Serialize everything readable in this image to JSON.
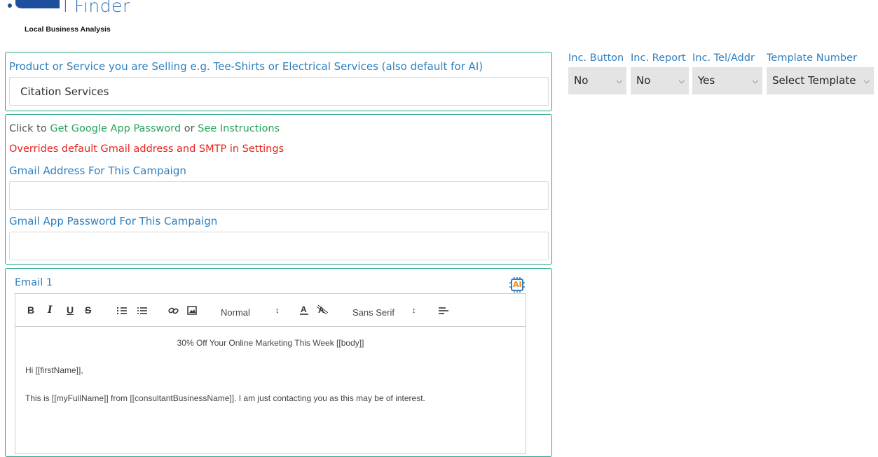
{
  "header": {
    "logo_text": "l Finder",
    "tagline": "Local Business Analysis"
  },
  "product": {
    "label": "Product or Service you are Selling e.g. Tee-Shirts or Electrical Services (also default for AI)",
    "value": "Citation Services"
  },
  "options": {
    "button": {
      "label": "Inc. Button",
      "value": "No"
    },
    "report": {
      "label": "Inc. Report",
      "value": "No"
    },
    "telAddr": {
      "label": "Inc. Tel/Addr",
      "value": "Yes"
    },
    "template": {
      "label": "Template Number",
      "value": "Select Template"
    }
  },
  "gmail": {
    "click_to": "Click to",
    "get_password_link": "Get Google App Password",
    "or": "or",
    "see_instructions_link": "See Instructions",
    "override_note": "Overrides default Gmail address and SMTP in Settings",
    "address_label": "Gmail Address For This Campaign",
    "address_value": "",
    "password_label": "Gmail App Password For This Campaign",
    "password_value": ""
  },
  "email": {
    "title": "Email 1",
    "ai_badge": "AI",
    "toolbar": {
      "bold": "B",
      "italic": "I",
      "underline": "U",
      "strike": "S",
      "size": "Normal",
      "font": "Sans Serif"
    },
    "body": {
      "subject_line": "30% Off Your Online Marketing This Week [[body]]",
      "greeting": "Hi [[firstName]],",
      "paragraph": "This is [[myFullName]] from [[consultantBusinessName]]. I am just contacting you as this may be of interest."
    }
  },
  "colors": {
    "accent_border": "#2aa68a",
    "label_blue": "#2f7fbf",
    "link_green": "#27a35a",
    "warning_red": "#e8231c"
  }
}
